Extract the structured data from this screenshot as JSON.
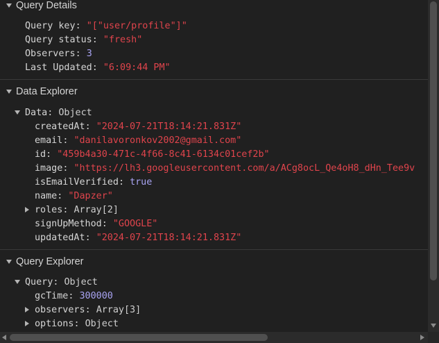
{
  "query_details": {
    "title": "Query Details",
    "rows": [
      {
        "key": "Query key",
        "value": "\"[\"user/profile\"]\""
      },
      {
        "key": "Query status",
        "value": "\"fresh\""
      },
      {
        "key": "Observers",
        "value": "3"
      },
      {
        "key": "Last Updated",
        "value": "\"6:09:44 PM\""
      }
    ]
  },
  "data_explorer": {
    "title": "Data Explorer",
    "root_key": "Data",
    "root_type": "Object",
    "fields": [
      {
        "key": "createdAt",
        "value": "\"2024-07-21T18:14:21.831Z\""
      },
      {
        "key": "email",
        "value": "\"danilavoronkov2002@gmail.com\""
      },
      {
        "key": "id",
        "value": "\"459b4a30-471c-4f66-8c41-6134c01cef2b\""
      },
      {
        "key": "image",
        "value": "\"https://lh3.googleusercontent.com/a/ACg8ocL_Qe4oH8_dHn_Tee9v"
      },
      {
        "key": "isEmailVerified",
        "value": "true"
      },
      {
        "key": "name",
        "value": "\"Dapzer\""
      },
      {
        "key": "roles",
        "value": "Array[2]"
      },
      {
        "key": "signUpMethod",
        "value": "\"GOOGLE\""
      },
      {
        "key": "updatedAt",
        "value": "\"2024-07-21T18:14:21.831Z\""
      }
    ]
  },
  "query_explorer": {
    "title": "Query Explorer",
    "root_key": "Query",
    "root_type": "Object",
    "fields": [
      {
        "key": "gcTime",
        "value": "300000"
      },
      {
        "key": "observers",
        "value": "Array[3]"
      },
      {
        "key": "options",
        "value": "Object"
      }
    ]
  },
  "colors": {
    "background": "#202020",
    "key": "#d6d6d6",
    "string": "#e0444c",
    "number": "#a9a4f3"
  },
  "scroll": {
    "vertical_fraction": 0.84,
    "horizontal_fraction": 0.6
  }
}
